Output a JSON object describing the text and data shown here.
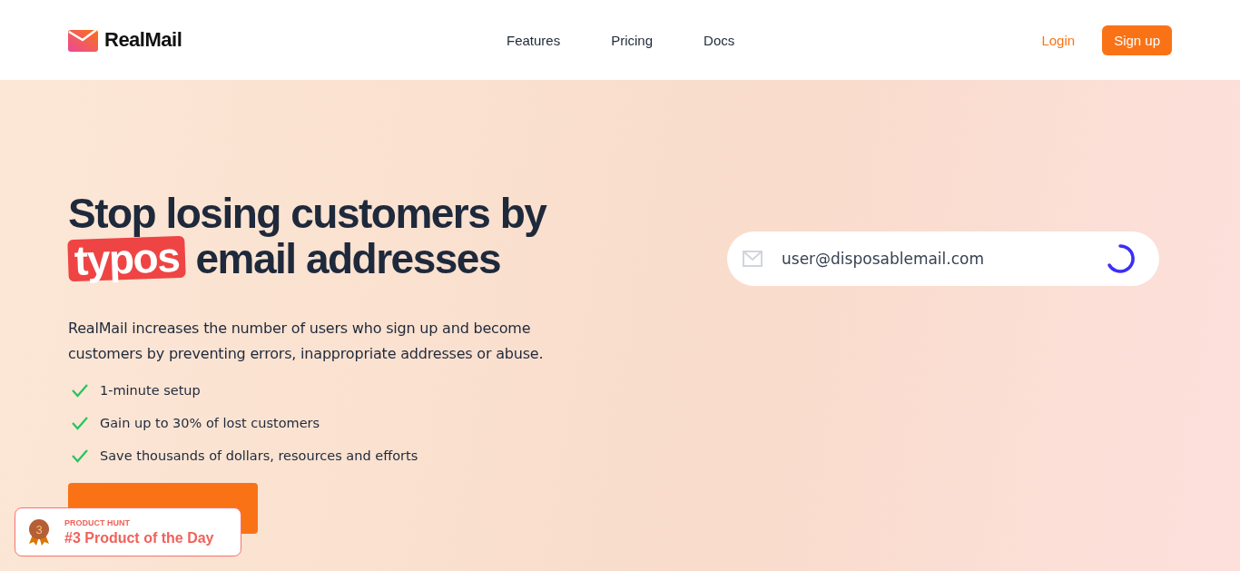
{
  "brand": {
    "name": "RealMail"
  },
  "nav": {
    "links": [
      "Features",
      "Pricing",
      "Docs"
    ],
    "login": "Login",
    "signup": "Sign up"
  },
  "hero": {
    "headline": {
      "lead": "Stop losing customers by",
      "highlight": "typos",
      "rest": "email addresses"
    },
    "description": "RealMail increases the number of users who sign up and become customers by preventing errors, inappropriate addresses or abuse.",
    "benefits": [
      "1-minute setup",
      "Gain up to 30% of lost customers",
      "Save thousands of dollars, resources and efforts"
    ],
    "demo_field": {
      "value": "user@disposablemail.com",
      "loading": true
    }
  },
  "badge": {
    "label": "PRODUCT HUNT",
    "title": "#3 Product of the Day",
    "rank": "3"
  }
}
